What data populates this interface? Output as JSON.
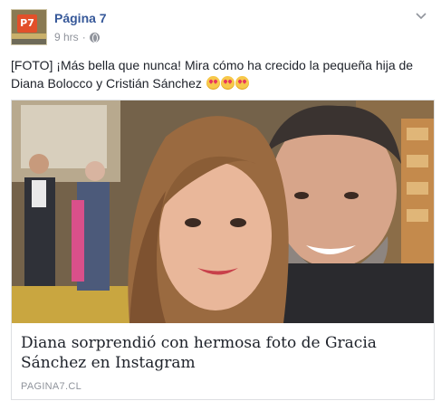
{
  "header": {
    "page_name": "Página 7",
    "avatar_text": "P7",
    "time": "9 hrs",
    "separator": "·",
    "privacy_icon": "globe-icon",
    "menu_icon": "chevron-down-icon"
  },
  "post": {
    "text": "[FOTO] ¡Más bella que nunca! Mira cómo ha crecido la pequeña hija de Diana Bolocco y Cristián Sánchez",
    "emoji_icon": "heart-eyes-emoji-icon",
    "emoji_count": 3
  },
  "attachment": {
    "title": "Diana sorprendió con hermosa foto de Gracia Sánchez en Instagram",
    "domain": "PAGINA7.CL"
  },
  "colors": {
    "link_blue": "#365899",
    "meta_gray": "#90949c",
    "text": "#1d2129",
    "border": "#dddfe2"
  }
}
